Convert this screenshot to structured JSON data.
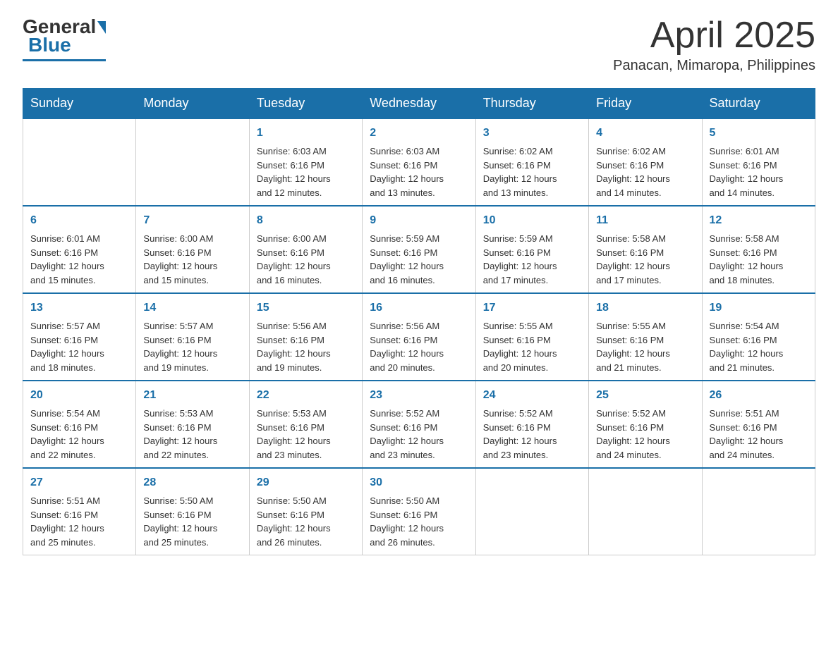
{
  "header": {
    "logo_general": "General",
    "logo_blue": "Blue",
    "month_title": "April 2025",
    "location": "Panacan, Mimaropa, Philippines"
  },
  "days_of_week": [
    "Sunday",
    "Monday",
    "Tuesday",
    "Wednesday",
    "Thursday",
    "Friday",
    "Saturday"
  ],
  "weeks": [
    [
      {
        "day": "",
        "info": ""
      },
      {
        "day": "",
        "info": ""
      },
      {
        "day": "1",
        "info": "Sunrise: 6:03 AM\nSunset: 6:16 PM\nDaylight: 12 hours\nand 12 minutes."
      },
      {
        "day": "2",
        "info": "Sunrise: 6:03 AM\nSunset: 6:16 PM\nDaylight: 12 hours\nand 13 minutes."
      },
      {
        "day": "3",
        "info": "Sunrise: 6:02 AM\nSunset: 6:16 PM\nDaylight: 12 hours\nand 13 minutes."
      },
      {
        "day": "4",
        "info": "Sunrise: 6:02 AM\nSunset: 6:16 PM\nDaylight: 12 hours\nand 14 minutes."
      },
      {
        "day": "5",
        "info": "Sunrise: 6:01 AM\nSunset: 6:16 PM\nDaylight: 12 hours\nand 14 minutes."
      }
    ],
    [
      {
        "day": "6",
        "info": "Sunrise: 6:01 AM\nSunset: 6:16 PM\nDaylight: 12 hours\nand 15 minutes."
      },
      {
        "day": "7",
        "info": "Sunrise: 6:00 AM\nSunset: 6:16 PM\nDaylight: 12 hours\nand 15 minutes."
      },
      {
        "day": "8",
        "info": "Sunrise: 6:00 AM\nSunset: 6:16 PM\nDaylight: 12 hours\nand 16 minutes."
      },
      {
        "day": "9",
        "info": "Sunrise: 5:59 AM\nSunset: 6:16 PM\nDaylight: 12 hours\nand 16 minutes."
      },
      {
        "day": "10",
        "info": "Sunrise: 5:59 AM\nSunset: 6:16 PM\nDaylight: 12 hours\nand 17 minutes."
      },
      {
        "day": "11",
        "info": "Sunrise: 5:58 AM\nSunset: 6:16 PM\nDaylight: 12 hours\nand 17 minutes."
      },
      {
        "day": "12",
        "info": "Sunrise: 5:58 AM\nSunset: 6:16 PM\nDaylight: 12 hours\nand 18 minutes."
      }
    ],
    [
      {
        "day": "13",
        "info": "Sunrise: 5:57 AM\nSunset: 6:16 PM\nDaylight: 12 hours\nand 18 minutes."
      },
      {
        "day": "14",
        "info": "Sunrise: 5:57 AM\nSunset: 6:16 PM\nDaylight: 12 hours\nand 19 minutes."
      },
      {
        "day": "15",
        "info": "Sunrise: 5:56 AM\nSunset: 6:16 PM\nDaylight: 12 hours\nand 19 minutes."
      },
      {
        "day": "16",
        "info": "Sunrise: 5:56 AM\nSunset: 6:16 PM\nDaylight: 12 hours\nand 20 minutes."
      },
      {
        "day": "17",
        "info": "Sunrise: 5:55 AM\nSunset: 6:16 PM\nDaylight: 12 hours\nand 20 minutes."
      },
      {
        "day": "18",
        "info": "Sunrise: 5:55 AM\nSunset: 6:16 PM\nDaylight: 12 hours\nand 21 minutes."
      },
      {
        "day": "19",
        "info": "Sunrise: 5:54 AM\nSunset: 6:16 PM\nDaylight: 12 hours\nand 21 minutes."
      }
    ],
    [
      {
        "day": "20",
        "info": "Sunrise: 5:54 AM\nSunset: 6:16 PM\nDaylight: 12 hours\nand 22 minutes."
      },
      {
        "day": "21",
        "info": "Sunrise: 5:53 AM\nSunset: 6:16 PM\nDaylight: 12 hours\nand 22 minutes."
      },
      {
        "day": "22",
        "info": "Sunrise: 5:53 AM\nSunset: 6:16 PM\nDaylight: 12 hours\nand 23 minutes."
      },
      {
        "day": "23",
        "info": "Sunrise: 5:52 AM\nSunset: 6:16 PM\nDaylight: 12 hours\nand 23 minutes."
      },
      {
        "day": "24",
        "info": "Sunrise: 5:52 AM\nSunset: 6:16 PM\nDaylight: 12 hours\nand 23 minutes."
      },
      {
        "day": "25",
        "info": "Sunrise: 5:52 AM\nSunset: 6:16 PM\nDaylight: 12 hours\nand 24 minutes."
      },
      {
        "day": "26",
        "info": "Sunrise: 5:51 AM\nSunset: 6:16 PM\nDaylight: 12 hours\nand 24 minutes."
      }
    ],
    [
      {
        "day": "27",
        "info": "Sunrise: 5:51 AM\nSunset: 6:16 PM\nDaylight: 12 hours\nand 25 minutes."
      },
      {
        "day": "28",
        "info": "Sunrise: 5:50 AM\nSunset: 6:16 PM\nDaylight: 12 hours\nand 25 minutes."
      },
      {
        "day": "29",
        "info": "Sunrise: 5:50 AM\nSunset: 6:16 PM\nDaylight: 12 hours\nand 26 minutes."
      },
      {
        "day": "30",
        "info": "Sunrise: 5:50 AM\nSunset: 6:16 PM\nDaylight: 12 hours\nand 26 minutes."
      },
      {
        "day": "",
        "info": ""
      },
      {
        "day": "",
        "info": ""
      },
      {
        "day": "",
        "info": ""
      }
    ]
  ]
}
